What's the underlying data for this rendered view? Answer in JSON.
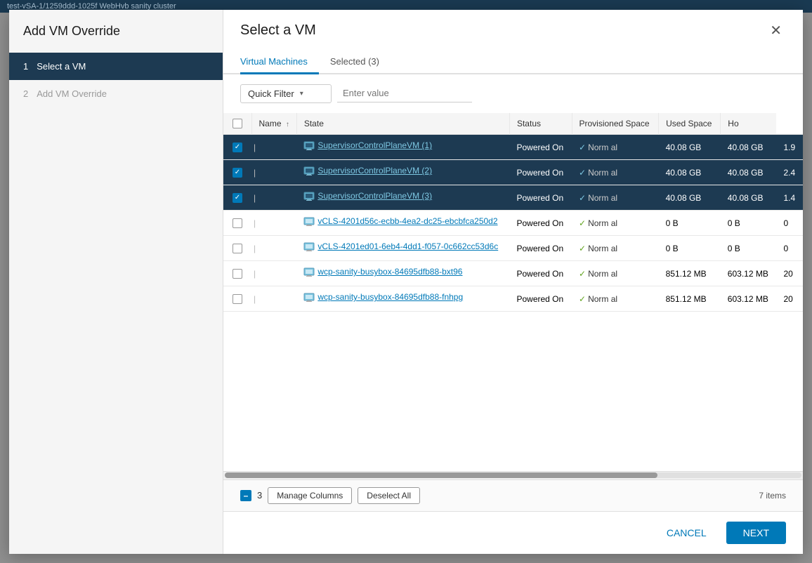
{
  "topbar": {
    "text": "test-vSA-1/1259ddd-1025f WebHvb sanity cluster"
  },
  "leftPanel": {
    "title": "Add VM Override",
    "steps": [
      {
        "number": "1",
        "label": "Select a VM",
        "active": true
      },
      {
        "number": "2",
        "label": "Add VM Override",
        "active": false
      }
    ]
  },
  "rightPanel": {
    "title": "Select a VM",
    "tabs": [
      {
        "label": "Virtual Machines",
        "active": true
      },
      {
        "label": "Selected (3)",
        "active": false
      }
    ],
    "filter": {
      "quickFilter": "Quick Filter",
      "placeholder": "Enter value"
    },
    "table": {
      "columns": [
        {
          "label": "",
          "key": "check"
        },
        {
          "label": "Name",
          "key": "name",
          "sortable": true
        },
        {
          "label": "State",
          "key": "state"
        },
        {
          "label": "Status",
          "key": "status"
        },
        {
          "label": "Provisioned Space",
          "key": "provisionedSpace"
        },
        {
          "label": "Used Space",
          "key": "usedSpace"
        },
        {
          "label": "Ho",
          "key": "ho"
        }
      ],
      "rows": [
        {
          "id": 1,
          "selected": true,
          "name": "SupervisorControlPlaneVM (1)",
          "state": "Powered On",
          "statusCheck": true,
          "statusLabel": "Norm al",
          "provisionedSpace": "40.08 GB",
          "usedSpace": "40.08 GB",
          "ho": "1.9"
        },
        {
          "id": 2,
          "selected": true,
          "name": "SupervisorControlPlaneVM (2)",
          "state": "Powered On",
          "statusCheck": true,
          "statusLabel": "Norm al",
          "provisionedSpace": "40.08 GB",
          "usedSpace": "40.08 GB",
          "ho": "2.4"
        },
        {
          "id": 3,
          "selected": true,
          "name": "SupervisorControlPlaneVM (3)",
          "state": "Powered On",
          "statusCheck": true,
          "statusLabel": "Norm al",
          "provisionedSpace": "40.08 GB",
          "usedSpace": "40.08 GB",
          "ho": "1.4"
        },
        {
          "id": 4,
          "selected": false,
          "name": "vCLS-4201d56c-ecbb-4ea2-dc25-ebcbfca250d2",
          "state": "Powered On",
          "statusCheck": true,
          "statusLabel": "Norm al",
          "provisionedSpace": "0 B",
          "usedSpace": "0 B",
          "ho": "0"
        },
        {
          "id": 5,
          "selected": false,
          "name": "vCLS-4201ed01-6eb4-4dd1-f057-0c662cc53d6c",
          "state": "Powered On",
          "statusCheck": true,
          "statusLabel": "Norm al",
          "provisionedSpace": "0 B",
          "usedSpace": "0 B",
          "ho": "0"
        },
        {
          "id": 6,
          "selected": false,
          "name": "wcp-sanity-busybox-84695dfb88-bxt96",
          "state": "Powered On",
          "statusCheck": true,
          "statusLabel": "Norm al",
          "provisionedSpace": "851.12 MB",
          "usedSpace": "603.12 MB",
          "ho": "20"
        },
        {
          "id": 7,
          "selected": false,
          "name": "wcp-sanity-busybox-84695dfb88-fnhpg",
          "state": "Powered On",
          "statusCheck": true,
          "statusLabel": "Norm al",
          "provisionedSpace": "851.12 MB",
          "usedSpace": "603.12 MB",
          "ho": "20"
        }
      ]
    },
    "footer": {
      "selectedCount": "3",
      "manageColumns": "Manage Columns",
      "deselectAll": "Deselect All",
      "itemCount": "7 items"
    },
    "actions": {
      "cancel": "CANCEL",
      "next": "NEXT"
    }
  }
}
